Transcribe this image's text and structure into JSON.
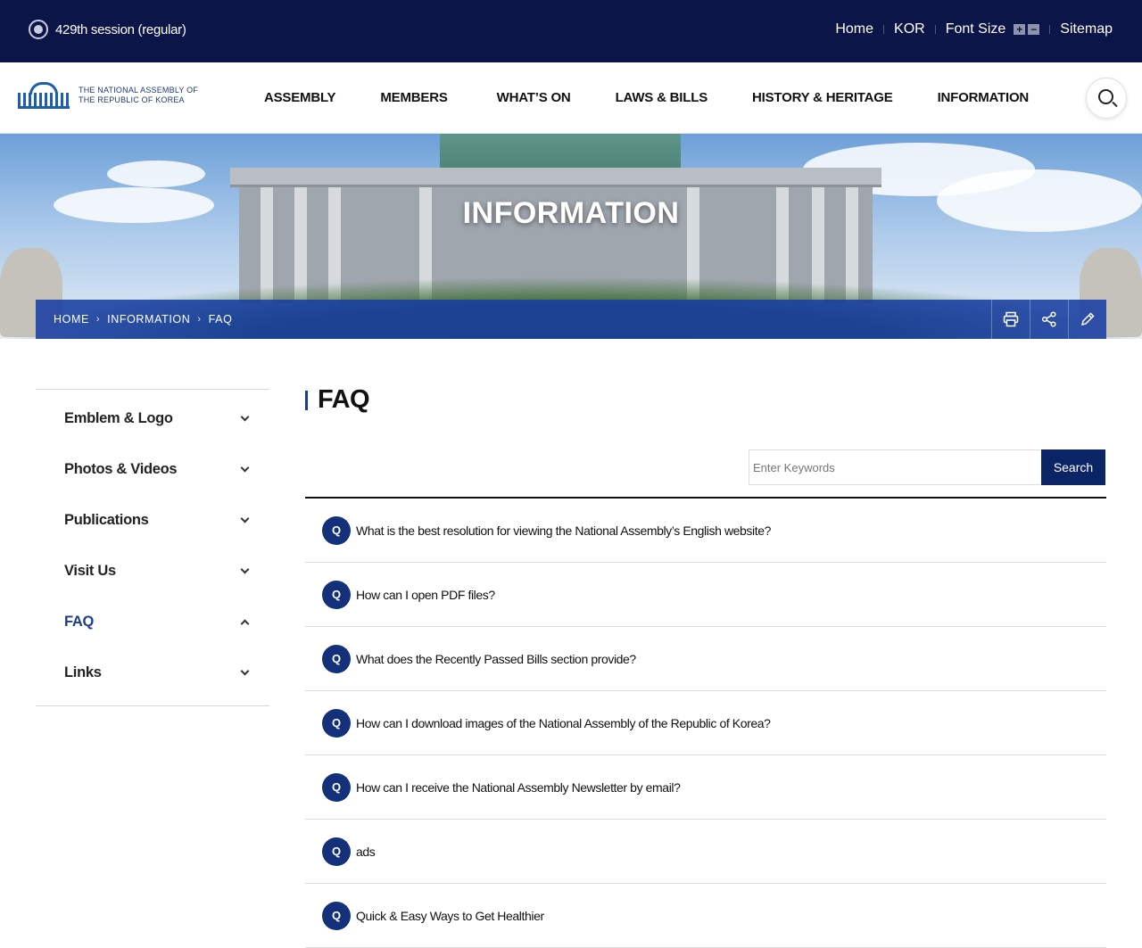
{
  "topbar": {
    "session": "429th session (regular)",
    "links": {
      "home": "Home",
      "kor": "KOR",
      "font_size": "Font Size",
      "plus": "+",
      "minus": "−",
      "sitemap": "Sitemap"
    }
  },
  "header": {
    "logo_line1": "THE NATIONAL ASSEMBLY OF",
    "logo_line2": "THE REPUBLIC OF KOREA",
    "nav": [
      "ASSEMBLY",
      "MEMBERS",
      "WHAT’S ON",
      "LAWS & BILLS",
      "HISTORY & HERITAGE",
      "INFORMATION"
    ]
  },
  "hero": {
    "title": "INFORMATION",
    "breadcrumb": [
      "HOME",
      "INFORMATION",
      "FAQ"
    ],
    "tools": [
      "print-icon",
      "share-icon",
      "edit-icon"
    ]
  },
  "sidebar": {
    "items": [
      {
        "label": "Emblem & Logo",
        "active": false
      },
      {
        "label": "Photos & Videos",
        "active": false
      },
      {
        "label": "Publications",
        "active": false
      },
      {
        "label": "Visit Us",
        "active": false
      },
      {
        "label": "FAQ",
        "active": true
      },
      {
        "label": "Links",
        "active": false
      }
    ]
  },
  "main": {
    "title": "FAQ",
    "search": {
      "placeholder": "Enter Keywords",
      "button": "Search"
    },
    "faq_badge": "Q",
    "faqs": [
      "What is the best resolution for viewing the National Assembly’s English website?",
      "How can I open PDF files?",
      "What does the Recently Passed Bills section provide?",
      "How can I download images of the National Assembly of the Republic of Korea?",
      "How can I receive the National Assembly Newsletter by email?",
      "ads",
      "Quick & Easy Ways to Get Healthier"
    ]
  },
  "colors": {
    "topbar": "#0b1548",
    "accent": "#1c3d8f",
    "button": "#0b2466"
  }
}
